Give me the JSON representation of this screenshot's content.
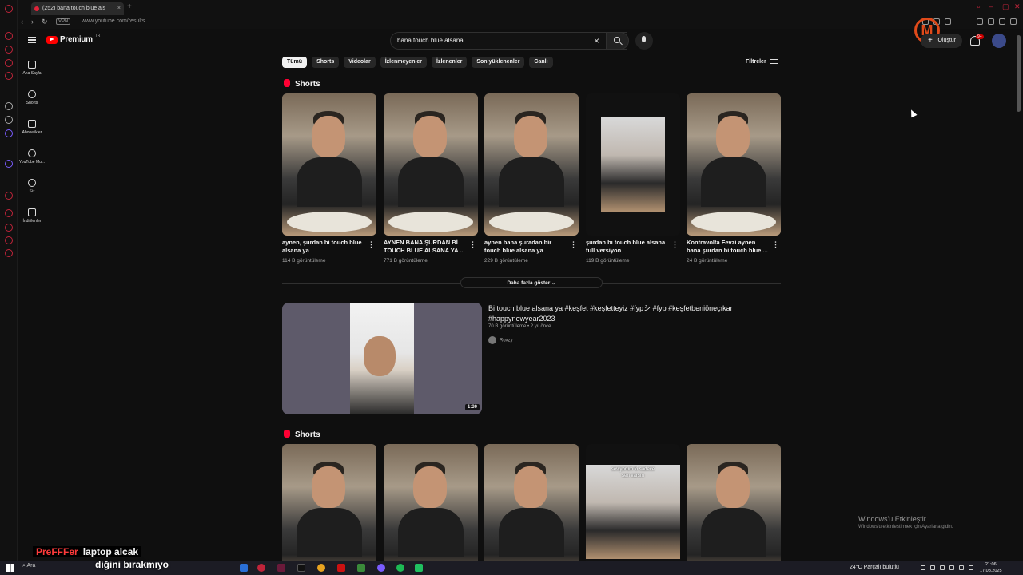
{
  "browser": {
    "tab_title": "(252) bana touch blue als",
    "url": "www.youtube.com/results",
    "vpn_label": "VPN"
  },
  "youtube": {
    "logo_text": "Premium",
    "logo_region": "TR",
    "search_value": "bana touch blue alsana",
    "create_label": "Oluştur",
    "notification_count": "9+",
    "nav": [
      "Ana Sayfa",
      "Shorts",
      "Abonelikler",
      "YouTube Mu...",
      "Siz",
      "İndirilenler"
    ],
    "chips": [
      "Tümü",
      "Shorts",
      "Videolar",
      "İzlenmeyenler",
      "İzlenenler",
      "Son yüklenenler",
      "Canlı"
    ],
    "filters_label": "Filtreler",
    "shorts_heading": "Shorts",
    "shorts_row1": [
      {
        "title": "aynen, şurdan bi touch blue alsana ya",
        "views": "114 B görüntüleme"
      },
      {
        "title": "AYNEN BANA ŞURDAN Bİ TOUCH BLUE ALSANA YA ...",
        "views": "771 B görüntüleme"
      },
      {
        "title": "aynen bana şuradan bir touch blue alsana ya",
        "views": "229 B görüntüleme"
      },
      {
        "title": "şurdan bı touch blue alsana full versiyon",
        "views": "119 B görüntüleme"
      },
      {
        "title": "Kontravolta Fevzi aynen bana şurdan bi touch blue ...",
        "views": "24 B görüntüleme"
      }
    ],
    "show_more": "Daha fazla göster",
    "video": {
      "title": "Bi touch blue alsana ya #keşfet #keşfetteyiz #fypシ #fyp #keşfetbeniöneçıkar #happynewyear2023",
      "meta": "70 B görüntüleme • 2 yıl önce",
      "channel": "Roxzy",
      "duration": "1:30"
    },
    "short_overlay_text": "seviyorum ki sadece sen varsın"
  },
  "overlay": {
    "watermark_title": "Windows'u Etkinleştir",
    "watermark_sub": "Windows'u etkinleştirmek için Ayarlar'a gidin.",
    "caption_brand": "PreFFFer",
    "caption_text": "laptop alcak",
    "caption_line2": "diğini bırakmıyo"
  },
  "taskbar": {
    "search": "Ara",
    "weather": "24°C  Parçalı bulutlu",
    "time": "21:06",
    "date": "17.08.2025"
  },
  "colors": {
    "accent": "#ff0033",
    "background": "#0f0f0f",
    "opera": "#c0243a"
  }
}
